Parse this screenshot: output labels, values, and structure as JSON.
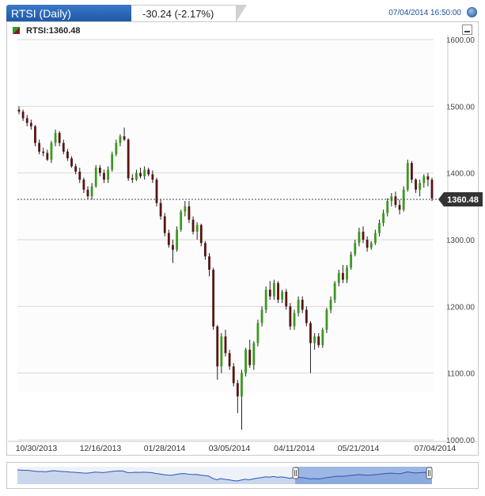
{
  "header": {
    "title": "RTSI (Daily)",
    "change": "-30.24 (-2.17%)",
    "timestamp": "07/04/2014 16:50:00"
  },
  "legend": {
    "label": "RTSI:1360.48"
  },
  "colors": {
    "up": "#3a9a1e",
    "down": "#5a1414",
    "accent": "#1e58a6",
    "grid": "#d9d9d9"
  },
  "chart_data": {
    "type": "candlestick",
    "ylim": [
      1000,
      1600
    ],
    "y_ticks": [
      "1600.00",
      "1500.00",
      "1400.00",
      "1300.00",
      "1200.00",
      "1100.00",
      "1000.00"
    ],
    "x_ticks": [
      "10/30/2013",
      "12/16/2013",
      "01/28/2014",
      "03/05/2014",
      "04/11/2014",
      "05/21/2014",
      "07/04/2014"
    ],
    "last_value": 1360.48,
    "last_label": "1360.48",
    "series": [
      {
        "values": [
          [
            1495,
            1500,
            1488,
            1492
          ],
          [
            1492,
            1495,
            1478,
            1482
          ],
          [
            1482,
            1487,
            1470,
            1475
          ],
          [
            1475,
            1480,
            1465,
            1470
          ],
          [
            1470,
            1472,
            1440,
            1445
          ],
          [
            1445,
            1450,
            1428,
            1432
          ],
          [
            1432,
            1438,
            1425,
            1430
          ],
          [
            1430,
            1435,
            1418,
            1420
          ],
          [
            1420,
            1448,
            1415,
            1445
          ],
          [
            1445,
            1465,
            1440,
            1460
          ],
          [
            1460,
            1463,
            1440,
            1445
          ],
          [
            1445,
            1450,
            1428,
            1432
          ],
          [
            1432,
            1436,
            1418,
            1422
          ],
          [
            1422,
            1425,
            1408,
            1410
          ],
          [
            1410,
            1414,
            1398,
            1402
          ],
          [
            1402,
            1408,
            1385,
            1390
          ],
          [
            1390,
            1393,
            1370,
            1375
          ],
          [
            1375,
            1380,
            1360,
            1365
          ],
          [
            1365,
            1385,
            1360,
            1380
          ],
          [
            1380,
            1412,
            1378,
            1408
          ],
          [
            1408,
            1412,
            1395,
            1400
          ],
          [
            1400,
            1405,
            1385,
            1390
          ],
          [
            1390,
            1410,
            1385,
            1405
          ],
          [
            1405,
            1432,
            1402,
            1428
          ],
          [
            1428,
            1450,
            1425,
            1445
          ],
          [
            1445,
            1458,
            1440,
            1455
          ],
          [
            1455,
            1468,
            1448,
            1450
          ],
          [
            1450,
            1452,
            1388,
            1392
          ],
          [
            1392,
            1398,
            1385,
            1390
          ],
          [
            1390,
            1405,
            1388,
            1400
          ],
          [
            1400,
            1408,
            1392,
            1395
          ],
          [
            1395,
            1410,
            1390,
            1405
          ],
          [
            1405,
            1408,
            1395,
            1398
          ],
          [
            1398,
            1404,
            1385,
            1390
          ],
          [
            1390,
            1393,
            1350,
            1355
          ],
          [
            1355,
            1360,
            1330,
            1335
          ],
          [
            1335,
            1340,
            1305,
            1310
          ],
          [
            1310,
            1315,
            1288,
            1292
          ],
          [
            1292,
            1300,
            1265,
            1285
          ],
          [
            1285,
            1320,
            1282,
            1315
          ],
          [
            1315,
            1345,
            1312,
            1342
          ],
          [
            1342,
            1358,
            1335,
            1350
          ],
          [
            1350,
            1358,
            1325,
            1330
          ],
          [
            1330,
            1335,
            1308,
            1312
          ],
          [
            1312,
            1326,
            1300,
            1322
          ],
          [
            1322,
            1324,
            1290,
            1295
          ],
          [
            1295,
            1298,
            1270,
            1275
          ],
          [
            1275,
            1280,
            1245,
            1255
          ],
          [
            1255,
            1258,
            1165,
            1170
          ],
          [
            1170,
            1172,
            1090,
            1110
          ],
          [
            1110,
            1160,
            1100,
            1155
          ],
          [
            1155,
            1165,
            1125,
            1130
          ],
          [
            1130,
            1135,
            1105,
            1110
          ],
          [
            1110,
            1115,
            1080,
            1085
          ],
          [
            1085,
            1090,
            1040,
            1065
          ],
          [
            1065,
            1105,
            1015,
            1100
          ],
          [
            1100,
            1138,
            1095,
            1135
          ],
          [
            1135,
            1150,
            1108,
            1112
          ],
          [
            1112,
            1148,
            1105,
            1145
          ],
          [
            1145,
            1180,
            1140,
            1175
          ],
          [
            1175,
            1200,
            1170,
            1195
          ],
          [
            1195,
            1230,
            1190,
            1225
          ],
          [
            1225,
            1238,
            1210,
            1215
          ],
          [
            1215,
            1240,
            1210,
            1235
          ],
          [
            1235,
            1238,
            1205,
            1210
          ],
          [
            1210,
            1225,
            1205,
            1222
          ],
          [
            1222,
            1226,
            1195,
            1200
          ],
          [
            1200,
            1205,
            1165,
            1170
          ],
          [
            1170,
            1195,
            1165,
            1190
          ],
          [
            1190,
            1215,
            1185,
            1210
          ],
          [
            1210,
            1215,
            1190,
            1195
          ],
          [
            1195,
            1200,
            1170,
            1175
          ],
          [
            1175,
            1178,
            1100,
            1145
          ],
          [
            1145,
            1160,
            1135,
            1155
          ],
          [
            1155,
            1160,
            1138,
            1142
          ],
          [
            1142,
            1168,
            1138,
            1165
          ],
          [
            1165,
            1198,
            1160,
            1195
          ],
          [
            1195,
            1215,
            1190,
            1210
          ],
          [
            1210,
            1238,
            1205,
            1235
          ],
          [
            1235,
            1255,
            1230,
            1250
          ],
          [
            1250,
            1262,
            1235,
            1240
          ],
          [
            1240,
            1262,
            1235,
            1258
          ],
          [
            1258,
            1282,
            1255,
            1278
          ],
          [
            1278,
            1300,
            1275,
            1295
          ],
          [
            1295,
            1318,
            1290,
            1312
          ],
          [
            1312,
            1320,
            1295,
            1300
          ],
          [
            1300,
            1305,
            1282,
            1288
          ],
          [
            1288,
            1298,
            1285,
            1295
          ],
          [
            1295,
            1315,
            1292,
            1310
          ],
          [
            1310,
            1330,
            1305,
            1325
          ],
          [
            1325,
            1345,
            1320,
            1340
          ],
          [
            1340,
            1362,
            1335,
            1358
          ],
          [
            1358,
            1370,
            1350,
            1365
          ],
          [
            1365,
            1372,
            1348,
            1352
          ],
          [
            1352,
            1360,
            1338,
            1345
          ],
          [
            1345,
            1380,
            1342,
            1375
          ],
          [
            1375,
            1420,
            1372,
            1415
          ],
          [
            1415,
            1418,
            1385,
            1390
          ],
          [
            1390,
            1392,
            1370,
            1375
          ],
          [
            1375,
            1390,
            1365,
            1385
          ],
          [
            1385,
            1398,
            1378,
            1395
          ],
          [
            1395,
            1400,
            1380,
            1390
          ],
          [
            1390,
            1393,
            1358,
            1362
          ]
        ]
      }
    ]
  }
}
